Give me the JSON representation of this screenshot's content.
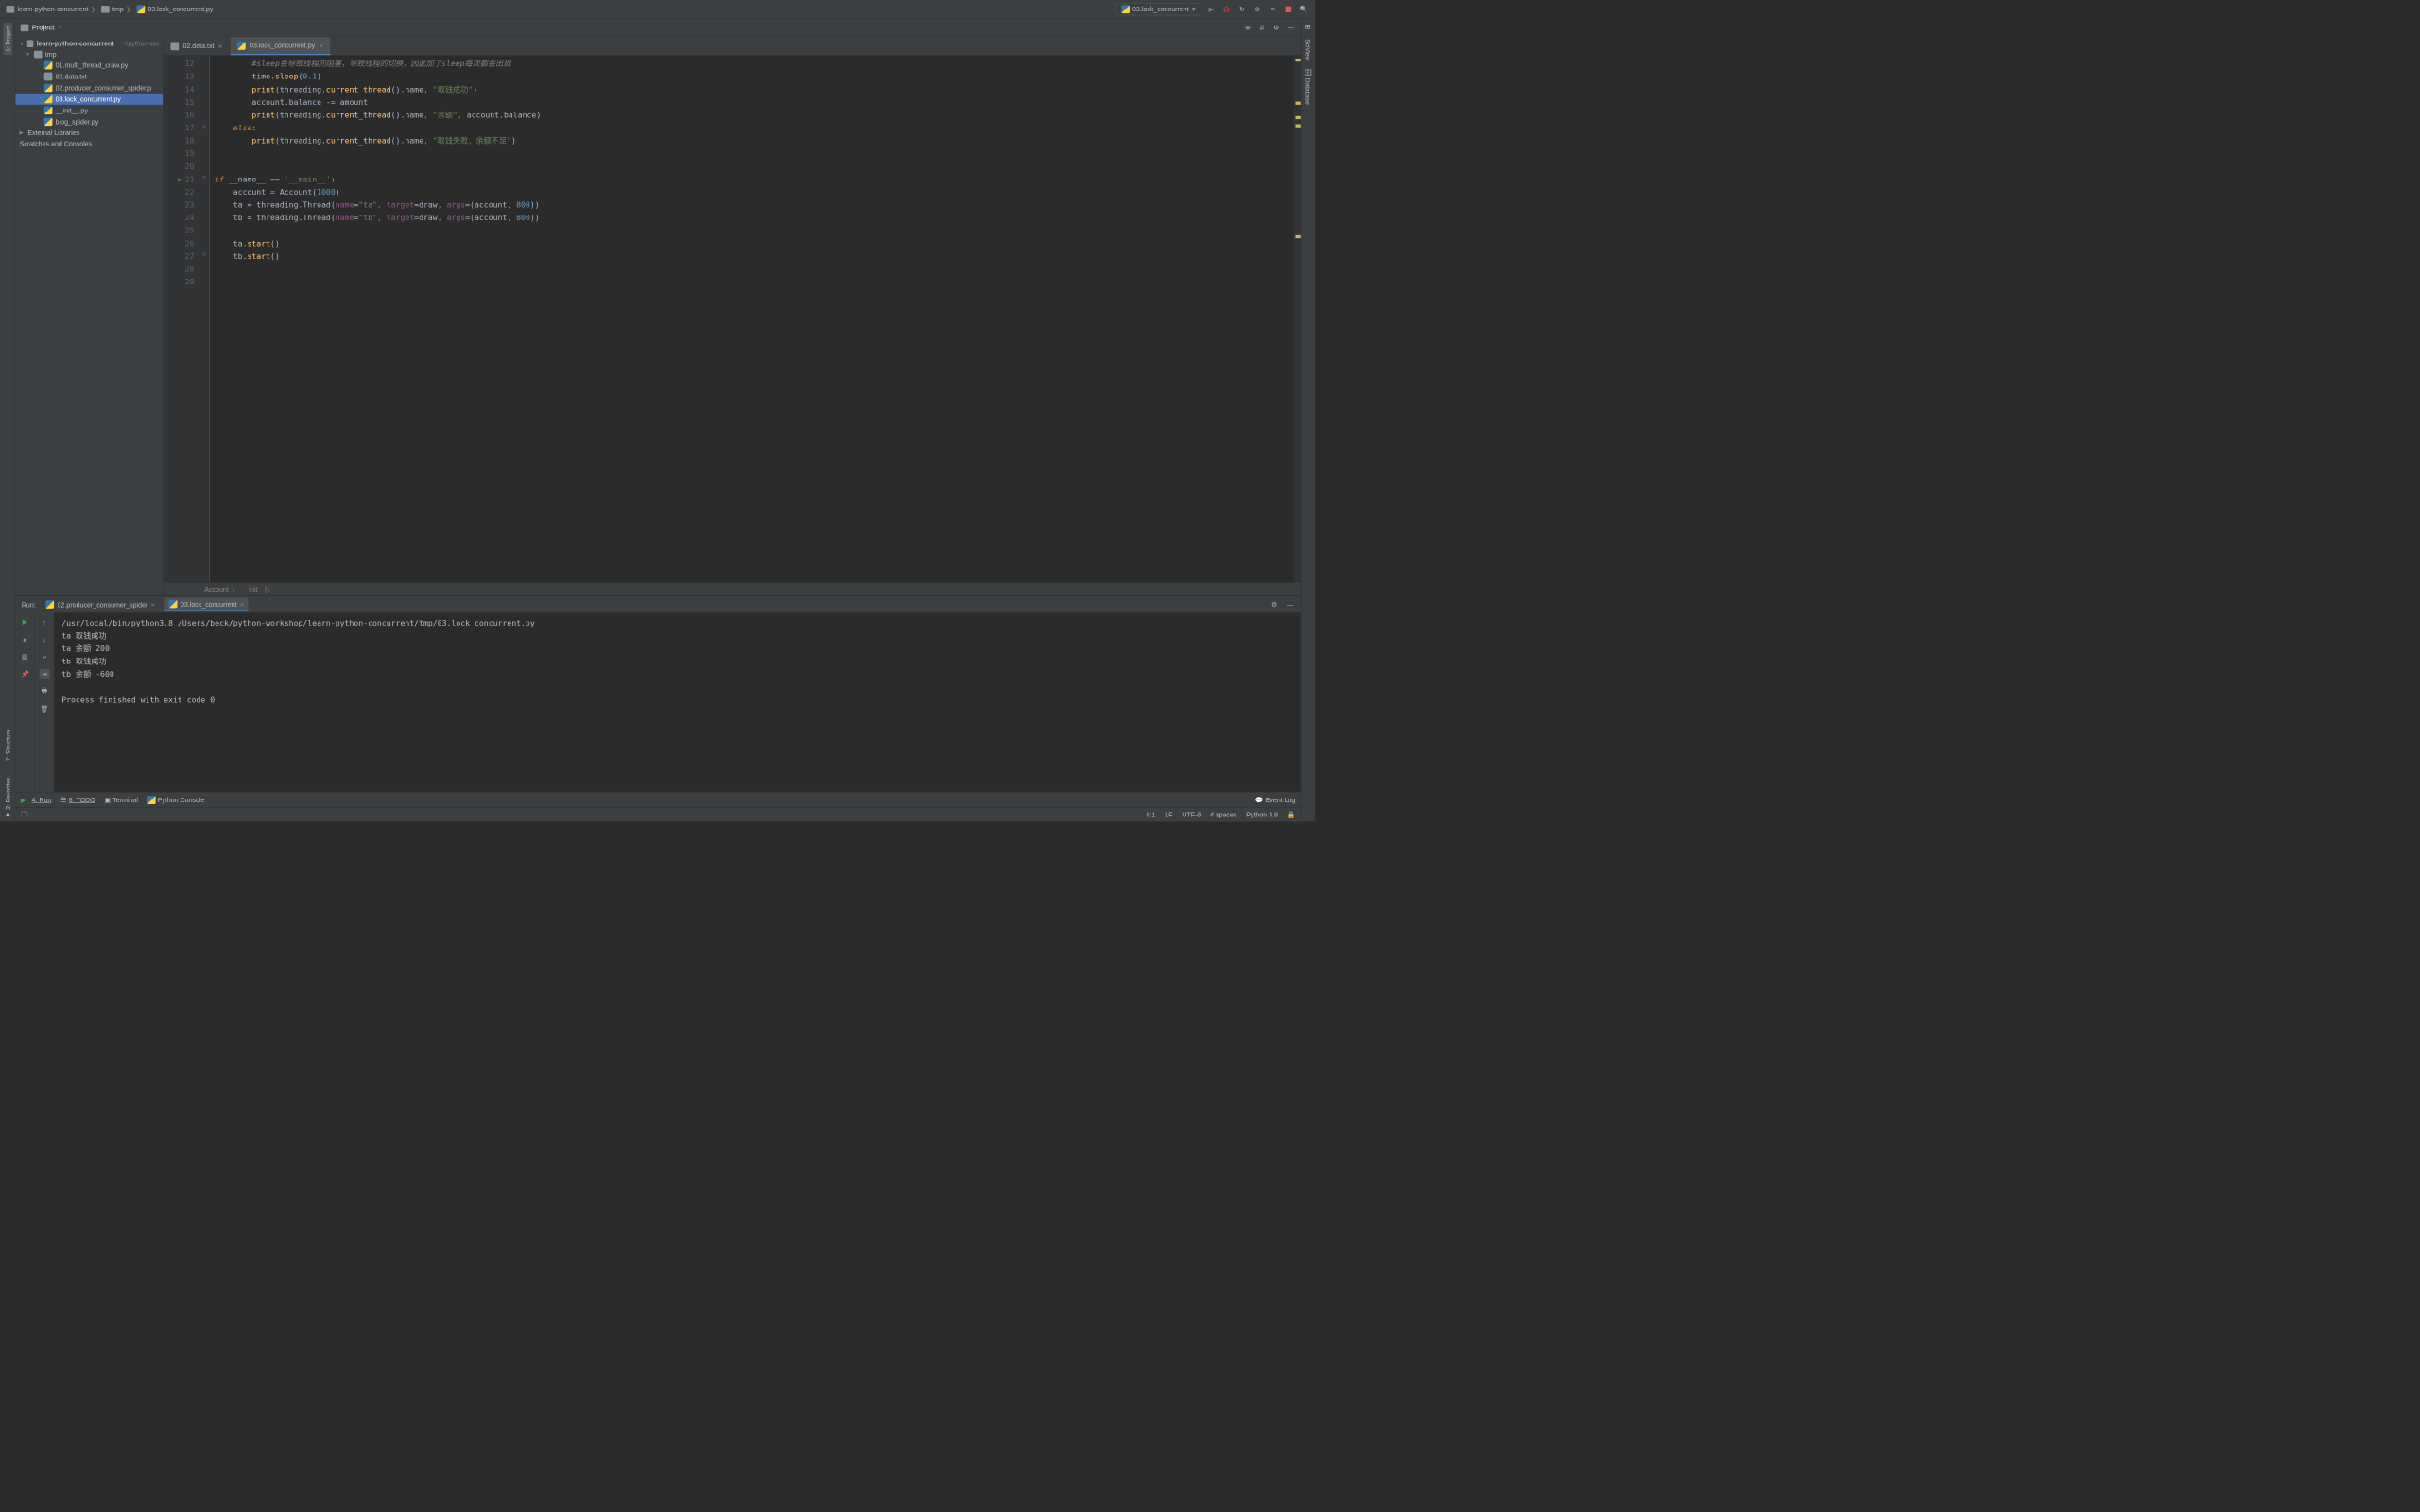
{
  "breadcrumb": {
    "root": "learn-python-concurrent",
    "folder": "tmp",
    "file": "03.lock_concurrent.py"
  },
  "run_config": {
    "label": "03.lock_concurrent"
  },
  "left_tool": "1: Project",
  "project_panel": {
    "title": "Project"
  },
  "tree": {
    "root": "learn-python-concurrent",
    "root_path": "~/python-wo",
    "folder": "tmp",
    "files": [
      "01.multi_thread_craw.py",
      "02.data.txt",
      "02.producer_consumer_spider.p",
      "03.lock_concurrent.py",
      "__init__.py",
      "blog_spider.py"
    ],
    "ext_lib": "External Libraries",
    "scratch": "Scratches and Consoles"
  },
  "tabs": [
    {
      "name": "02.data.txt",
      "type": "txt"
    },
    {
      "name": "03.lock_concurrent.py",
      "type": "py",
      "active": true
    }
  ],
  "code": {
    "first_line": 12,
    "comment": "#sleep会导致线程的阻塞，导致线程的切换，因此加了sleep每次都会出现",
    "str_success": "\"取钱成功\"",
    "str_balance": "\"余额\"",
    "str_fail": "\"取钱失败，余额不足\"",
    "main": "'__main__'"
  },
  "editor_crumb": {
    "a": "Account",
    "b": "__init__()"
  },
  "right_tools": [
    "SciView",
    "Database"
  ],
  "run": {
    "label": "Run:",
    "tabs": [
      {
        "name": "02.producer_consumer_spider"
      },
      {
        "name": "03.lock_concurrent",
        "active": true
      }
    ],
    "lines": [
      "/usr/local/bin/python3.8 /Users/beck/python-workshop/learn-python-concurrent/tmp/03.lock_concurrent.py",
      "ta 取钱成功",
      "ta 余额 200",
      "tb 取钱成功",
      "tb 余额 -600",
      "",
      "Process finished with exit code 0"
    ]
  },
  "bottom": {
    "run": "4: Run",
    "todo": "6: TODO",
    "term": "Terminal",
    "pycon": "Python Console",
    "eventlog": "Event Log"
  },
  "status": {
    "pos": "8:1",
    "le": "LF",
    "enc": "UTF-8",
    "indent": "4 spaces",
    "py": "Python 3.8"
  },
  "left_tools2": [
    "7: Structure",
    "2: Favorites"
  ]
}
